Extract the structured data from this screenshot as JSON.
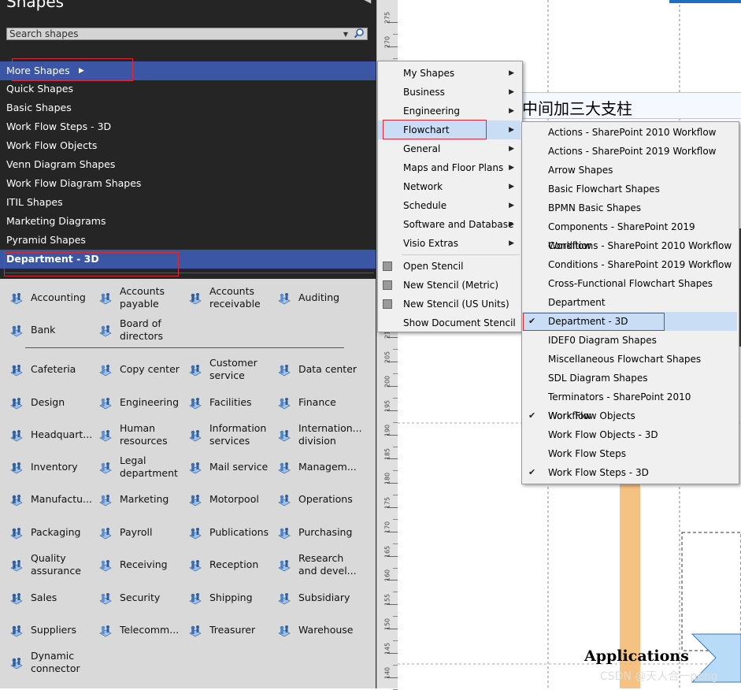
{
  "panel": {
    "title": "Shapes",
    "search_placeholder": "Search shapes",
    "items": [
      {
        "label": "More Shapes"
      },
      {
        "label": "Quick Shapes"
      },
      {
        "label": "Basic Shapes"
      },
      {
        "label": "Work Flow Steps - 3D"
      },
      {
        "label": "Work Flow Objects"
      },
      {
        "label": "Venn Diagram Shapes"
      },
      {
        "label": "Work Flow Diagram Shapes"
      },
      {
        "label": "ITIL Shapes"
      },
      {
        "label": "Marketing Diagrams"
      },
      {
        "label": "Pyramid Shapes"
      },
      {
        "label": "Department - 3D"
      }
    ]
  },
  "stencil": {
    "shapes": [
      {
        "label": "Accounting",
        "icon": "accounting-icon"
      },
      {
        "label": "Accounts\npayable",
        "icon": "accounts-payable-icon"
      },
      {
        "label": "Accounts\nreceivable",
        "icon": "accounts-receivable-icon"
      },
      {
        "label": "Auditing",
        "icon": "auditing-icon"
      },
      {
        "label": "Bank",
        "icon": "bank-icon"
      },
      {
        "label": "Board of\ndirectors",
        "icon": "board-icon"
      },
      {
        "label": "Cafeteria",
        "icon": "cafeteria-icon"
      },
      {
        "label": "Copy center",
        "icon": "copy-center-icon"
      },
      {
        "label": "Customer\nservice",
        "icon": "customer-service-icon"
      },
      {
        "label": "Data center",
        "icon": "data-center-icon"
      },
      {
        "label": "Design",
        "icon": "design-icon"
      },
      {
        "label": "Engineering",
        "icon": "engineering-icon"
      },
      {
        "label": "Facilities",
        "icon": "facilities-icon"
      },
      {
        "label": "Finance",
        "icon": "finance-icon"
      },
      {
        "label": "Headquart...",
        "icon": "headquarters-icon"
      },
      {
        "label": "Human\nresources",
        "icon": "human-resources-icon"
      },
      {
        "label": "Information\nservices",
        "icon": "information-services-icon"
      },
      {
        "label": "Internation...\ndivision",
        "icon": "international-icon"
      },
      {
        "label": "Inventory",
        "icon": "inventory-icon"
      },
      {
        "label": "Legal\ndepartment",
        "icon": "legal-icon"
      },
      {
        "label": "Mail service",
        "icon": "mail-service-icon"
      },
      {
        "label": "Managem...",
        "icon": "management-icon"
      },
      {
        "label": "Manufactu...",
        "icon": "manufacturing-icon"
      },
      {
        "label": "Marketing",
        "icon": "marketing-icon"
      },
      {
        "label": "Motorpool",
        "icon": "motorpool-icon"
      },
      {
        "label": "Operations",
        "icon": "operations-icon"
      },
      {
        "label": "Packaging",
        "icon": "packaging-icon"
      },
      {
        "label": "Payroll",
        "icon": "payroll-icon"
      },
      {
        "label": "Publications",
        "icon": "publications-icon"
      },
      {
        "label": "Purchasing",
        "icon": "purchasing-icon"
      },
      {
        "label": "Quality\nassurance",
        "icon": "quality-icon"
      },
      {
        "label": "Receiving",
        "icon": "receiving-icon"
      },
      {
        "label": "Reception",
        "icon": "reception-icon"
      },
      {
        "label": "Research\nand devel...",
        "icon": "research-icon"
      },
      {
        "label": "Sales",
        "icon": "sales-icon"
      },
      {
        "label": "Security",
        "icon": "security-icon"
      },
      {
        "label": "Shipping",
        "icon": "shipping-icon"
      },
      {
        "label": "Subsidiary",
        "icon": "subsidiary-icon"
      },
      {
        "label": "Suppliers",
        "icon": "suppliers-icon"
      },
      {
        "label": "Telecomm...",
        "icon": "telecom-icon"
      },
      {
        "label": "Treasurer",
        "icon": "treasurer-icon"
      },
      {
        "label": "Warehouse",
        "icon": "warehouse-icon"
      },
      {
        "label": "Dynamic\nconnector",
        "icon": "dynamic-connector-icon"
      }
    ]
  },
  "ruler": {
    "labels": [
      "275",
      "270",
      "265",
      "260",
      "255",
      "250",
      "245",
      "240",
      "235",
      "230",
      "225",
      "220",
      "215",
      "210",
      "205",
      "200",
      "195",
      "190",
      "185",
      "180",
      "175",
      "170",
      "165",
      "160",
      "155",
      "150",
      "145",
      "140"
    ]
  },
  "more_shapes_menu": {
    "items": [
      {
        "label": "My Shapes",
        "submenu": true
      },
      {
        "label": "Business",
        "submenu": true
      },
      {
        "label": "Engineering",
        "submenu": true
      },
      {
        "label": "Flowchart",
        "submenu": true
      },
      {
        "label": "General",
        "submenu": true
      },
      {
        "label": "Maps and Floor Plans",
        "submenu": true
      },
      {
        "label": "Network",
        "submenu": true
      },
      {
        "label": "Schedule",
        "submenu": true
      },
      {
        "label": "Software and Database",
        "submenu": true
      },
      {
        "label": "Visio Extras",
        "submenu": true
      },
      {
        "label": "Open Stencil",
        "icon": "open-stencil-icon"
      },
      {
        "label": "New Stencil (Metric)",
        "icon": "new-stencil-icon"
      },
      {
        "label": "New Stencil (US Units)",
        "icon": "new-stencil-icon"
      },
      {
        "label": "Show Document Stencil"
      }
    ]
  },
  "flowchart_menu": {
    "items": [
      {
        "label": "Actions - SharePoint 2010 Workflow",
        "checked": false
      },
      {
        "label": "Actions - SharePoint 2019 Workflow",
        "checked": false
      },
      {
        "label": "Arrow Shapes",
        "checked": false
      },
      {
        "label": "Basic Flowchart Shapes",
        "checked": false
      },
      {
        "label": "BPMN Basic Shapes",
        "checked": false
      },
      {
        "label": "Components - SharePoint 2019 Workflow",
        "checked": false
      },
      {
        "label": "Conditions - SharePoint 2010 Workflow",
        "checked": false
      },
      {
        "label": "Conditions - SharePoint 2019 Workflow",
        "checked": false
      },
      {
        "label": "Cross-Functional Flowchart Shapes",
        "checked": false
      },
      {
        "label": "Department",
        "checked": false
      },
      {
        "label": "Department - 3D",
        "checked": true
      },
      {
        "label": "IDEF0 Diagram Shapes",
        "checked": false
      },
      {
        "label": "Miscellaneous Flowchart Shapes",
        "checked": false
      },
      {
        "label": "SDL Diagram Shapes",
        "checked": false
      },
      {
        "label": "Terminators - SharePoint 2010 Workflow",
        "checked": false
      },
      {
        "label": "Work Flow Objects",
        "checked": true
      },
      {
        "label": "Work Flow Objects - 3D",
        "checked": false
      },
      {
        "label": "Work Flow Steps",
        "checked": false
      },
      {
        "label": "Work Flow Steps - 3D",
        "checked": true
      }
    ]
  },
  "canvas": {
    "header_text": "中间加三大支柱",
    "applications_label": "Applications",
    "watermark": "CSDN @天人合一peng"
  },
  "colors": {
    "panel_bg": "#252526",
    "selected": "#3a56a5",
    "highlight_red": "#e0262e",
    "stencil_bg": "#d9d9d9",
    "menu_hover": "#c9ddf5"
  }
}
